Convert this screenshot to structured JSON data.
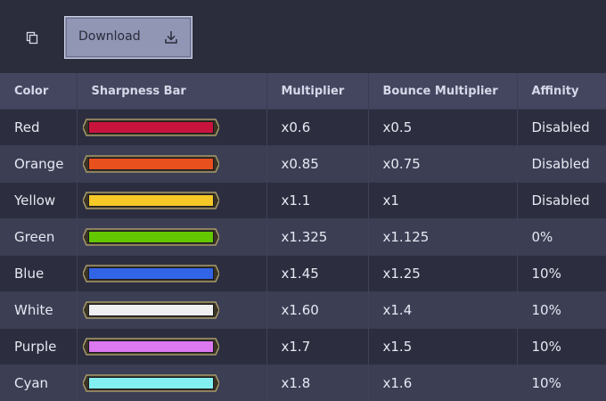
{
  "toolbar": {
    "copy_icon": "copy-icon",
    "download_label": "Download",
    "download_icon": "download-icon"
  },
  "table": {
    "headers": [
      "Color",
      "Sharpness Bar",
      "Multiplier",
      "Bounce Multiplier",
      "Affinity"
    ],
    "rows": [
      {
        "color": "Red",
        "bar_color": "#c8143c",
        "multiplier": "x0.6",
        "bounce": "x0.5",
        "affinity": "Disabled"
      },
      {
        "color": "Orange",
        "bar_color": "#e8501e",
        "multiplier": "x0.85",
        "bounce": "x0.75",
        "affinity": "Disabled"
      },
      {
        "color": "Yellow",
        "bar_color": "#f5c828",
        "multiplier": "x1.1",
        "bounce": "x1",
        "affinity": "Disabled"
      },
      {
        "color": "Green",
        "bar_color": "#64c800",
        "multiplier": "x1.325",
        "bounce": "x1.125",
        "affinity": "0%"
      },
      {
        "color": "Blue",
        "bar_color": "#3264e6",
        "multiplier": "x1.45",
        "bounce": "x1.25",
        "affinity": "10%"
      },
      {
        "color": "White",
        "bar_color": "#f0f0f0",
        "multiplier": "x1.60",
        "bounce": "x1.4",
        "affinity": "10%"
      },
      {
        "color": "Purple",
        "bar_color": "#dc78f0",
        "multiplier": "x1.7",
        "bounce": "x1.5",
        "affinity": "10%"
      },
      {
        "color": "Cyan",
        "bar_color": "#82f0f0",
        "multiplier": "x1.8",
        "bounce": "x1.6",
        "affinity": "10%"
      }
    ]
  },
  "colors": {
    "background": "#2b2d3d",
    "header_bg": "#444660",
    "row_odd": "#2c2e3f",
    "row_even": "#3c3e54",
    "bar_frame": "#a89a6c",
    "button_bg": "#9296b5"
  }
}
